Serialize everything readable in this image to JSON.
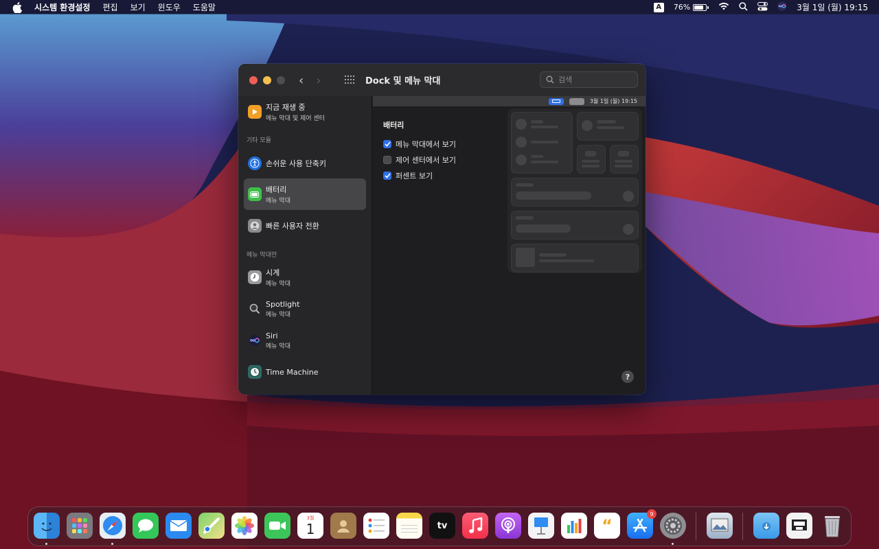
{
  "menubar": {
    "app_name": "시스템 환경설정",
    "menus": [
      "편집",
      "보기",
      "윈도우",
      "도움말"
    ],
    "input_source": "A",
    "battery_percent": "76%",
    "datetime": "3월 1일 (월)  19:15"
  },
  "window": {
    "title": "Dock 및 메뉴 막대",
    "search_placeholder": "검색",
    "back_symbol": "‹",
    "forward_symbol": "›"
  },
  "sidebar": {
    "now_playing": {
      "title": "지금 재생 중",
      "sub": "메뉴 막대 및 제어 센터"
    },
    "section_other": "기타 모듈",
    "accessibility": {
      "title": "손쉬운 사용 단축키"
    },
    "battery": {
      "title": "배터리",
      "sub": "메뉴 막대"
    },
    "fast_user": {
      "title": "빠른 사용자 전환"
    },
    "section_menubar_only": "메뉴 막대만",
    "clock": {
      "title": "시계",
      "sub": "메뉴 막대"
    },
    "spotlight": {
      "title": "Spotlight",
      "sub": "메뉴 막대"
    },
    "siri": {
      "title": "Siri",
      "sub": "메뉴 막대"
    },
    "time_machine": {
      "title": "Time Machine"
    }
  },
  "content": {
    "preview_datetime": "3월 1일 (월)  19:15",
    "section_title": "배터리",
    "options": [
      {
        "label": "메뉴 막대에서 보기",
        "checked": true
      },
      {
        "label": "제어 센터에서 보기",
        "checked": false
      },
      {
        "label": "퍼센트 보기",
        "checked": true
      }
    ],
    "help_label": "?"
  },
  "dock": {
    "calendar_month": "3월",
    "calendar_day": "1",
    "appstore_badge": "9",
    "tv_label": "tv",
    "keynote_quote": "“"
  },
  "colors": {
    "accent": "#2f6fe6",
    "selected_sidebar": "#464649",
    "window_bg": "#1e1e20"
  }
}
